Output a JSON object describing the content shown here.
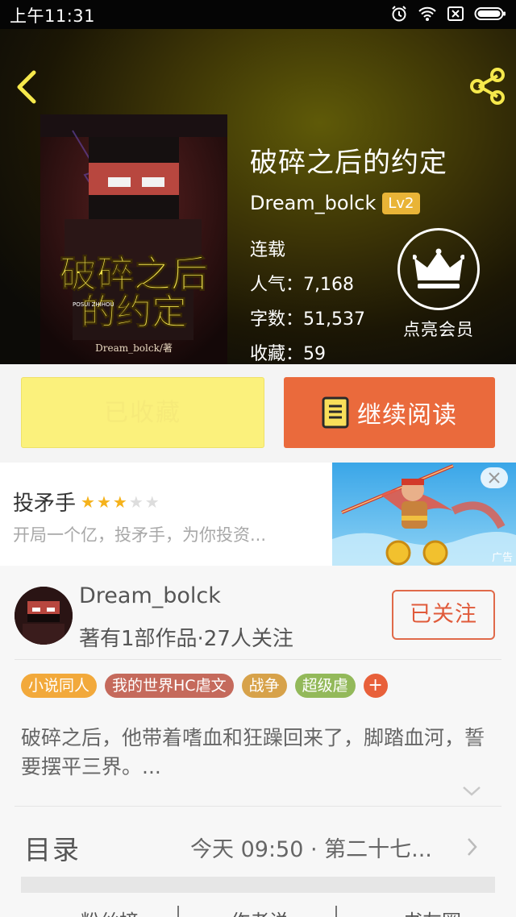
{
  "status_bar": {
    "time": "上午11:31",
    "icons": [
      "alarm-icon",
      "wifi-icon",
      "no-sim-icon",
      "battery-icon"
    ]
  },
  "book": {
    "title": "破碎之后的约定",
    "author": "Dream_bolck",
    "author_level": "Lv2",
    "status": "连载",
    "popularity": "人气：7,168",
    "word_count": "字数：51,537",
    "favorites": "收藏：59",
    "cover_title_line1": "破碎之后",
    "cover_title_line2": "的约定",
    "cover_pinyin": "POSUI ZHIHOU",
    "cover_author": "Dream_bolck/著"
  },
  "member": {
    "label": "点亮会员"
  },
  "actions": {
    "collected_label": "已收藏",
    "read_label": "继续阅读"
  },
  "ad": {
    "title": "投矛手",
    "rating": 3,
    "rating_max": 5,
    "description": "开局一个亿，投矛手，为你投资...",
    "tag": "广告"
  },
  "author_card": {
    "name": "Dream_bolck",
    "subtitle": "著有1部作品·27人关注",
    "follow_label": "已关注"
  },
  "tags": [
    {
      "label": "小说同人",
      "color": "#f2a93b"
    },
    {
      "label": "我的世界HC虐文",
      "color": "#c56a5c"
    },
    {
      "label": "战争",
      "color": "#d7a24a"
    },
    {
      "label": "超级虐",
      "color": "#93b95a"
    }
  ],
  "tag_add": "+",
  "description": "破碎之后，他带着嗜血和狂躁回来了，脚踏血河，誓要摆平三界。...",
  "toc": {
    "title": "目录",
    "latest": "今天 09:50 · 第二十七..."
  },
  "bottom_tabs": [
    "粉丝榜",
    "作者说",
    "书友圈"
  ],
  "colors": {
    "accent": "#ea6a3c",
    "collected_bg": "#fbf17c",
    "follow": "#e05a3a",
    "level_badge": "#e9b437"
  }
}
